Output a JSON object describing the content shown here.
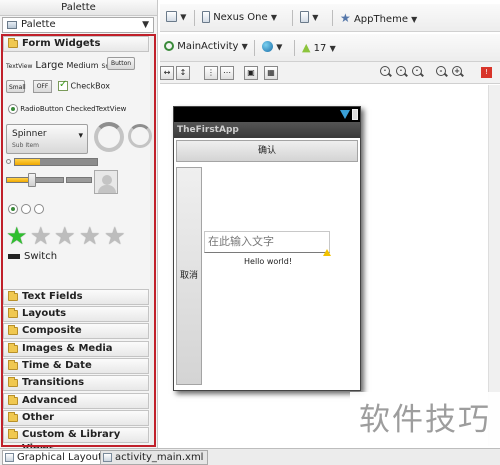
{
  "palette": {
    "title": "Palette",
    "select_value": "Palette",
    "categories": [
      {
        "label": "Form Widgets",
        "icon": "folder-icon",
        "expanded": true
      },
      {
        "label": "Text Fields",
        "icon": "folder-icon"
      },
      {
        "label": "Layouts",
        "icon": "folder-icon"
      },
      {
        "label": "Composite",
        "icon": "folder-icon"
      },
      {
        "label": "Images & Media",
        "icon": "folder-icon"
      },
      {
        "label": "Time & Date",
        "icon": "folder-icon"
      },
      {
        "label": "Transitions",
        "icon": "folder-icon"
      },
      {
        "label": "Advanced",
        "icon": "folder-icon"
      },
      {
        "label": "Other",
        "icon": "folder-icon"
      },
      {
        "label": "Custom & Library Views",
        "icon": "folder-icon"
      }
    ],
    "widgets": {
      "textview": "TextView",
      "large": "Large",
      "medium": "Medium",
      "small": "Small",
      "button": "Button",
      "small_button": "Small",
      "toggle_off": "OFF",
      "checkbox": "CheckBox",
      "radiobutton": "RadioButton",
      "checkedtextview": "CheckedTextView",
      "spinner": "Spinner",
      "spinner_sub": "Sub Item",
      "switch": "Switch",
      "progress": 0.3,
      "seek": 0.3,
      "rating_stars": 5,
      "rating_value": 1
    },
    "highlight_color": "#c0202a"
  },
  "toolbar": {
    "device": "Nexus One",
    "theme": "AppTheme",
    "activity": "MainActivity",
    "api_level": "17"
  },
  "device": {
    "app_title": "TheFirstApp",
    "confirm_button": "确认",
    "cancel_button": "取消",
    "input_placeholder": "在此输入文字",
    "hello_text": "Hello world!"
  },
  "watermark": "软件技巧",
  "bottom_tabs": [
    {
      "label": "Graphical Layout",
      "active": true
    },
    {
      "label": "activity_main.xml",
      "active": false
    }
  ]
}
